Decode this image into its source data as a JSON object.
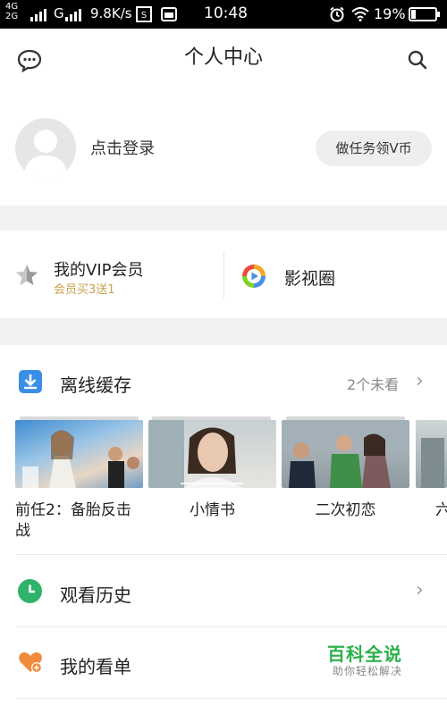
{
  "status_bar": {
    "network_top": "4G",
    "network_bottom": "2G",
    "carrier": "G",
    "speed": "9.8K/s",
    "time": "10:48",
    "battery": "19%"
  },
  "header": {
    "title": "个人中心",
    "message_icon": "chat-bubble-icon",
    "search_icon": "search-icon"
  },
  "profile": {
    "login_label": "点击登录",
    "task_button": "做任务领V币"
  },
  "vip": {
    "title": "我的VIP会员",
    "subtitle": "会员买3送1",
    "circle_label": "影视圈"
  },
  "offline": {
    "title": "离线缓存",
    "unwatched": "2个未看",
    "videos": [
      {
        "title": "前任2：备胎反击战"
      },
      {
        "title": "小情书"
      },
      {
        "title": "二次初恋"
      },
      {
        "title": "六"
      }
    ]
  },
  "history": {
    "title": "观看历史"
  },
  "watchlist": {
    "title": "我的看单"
  },
  "watermark": {
    "name": "百科全说",
    "slogan": "助你轻松解决"
  },
  "colors": {
    "accent_green": "#2bb04a",
    "vip_gold": "#c9a24a",
    "offline_blue": "#3a8ee6",
    "history_green": "#2fb36a",
    "watchlist_orange": "#f08a3c"
  }
}
